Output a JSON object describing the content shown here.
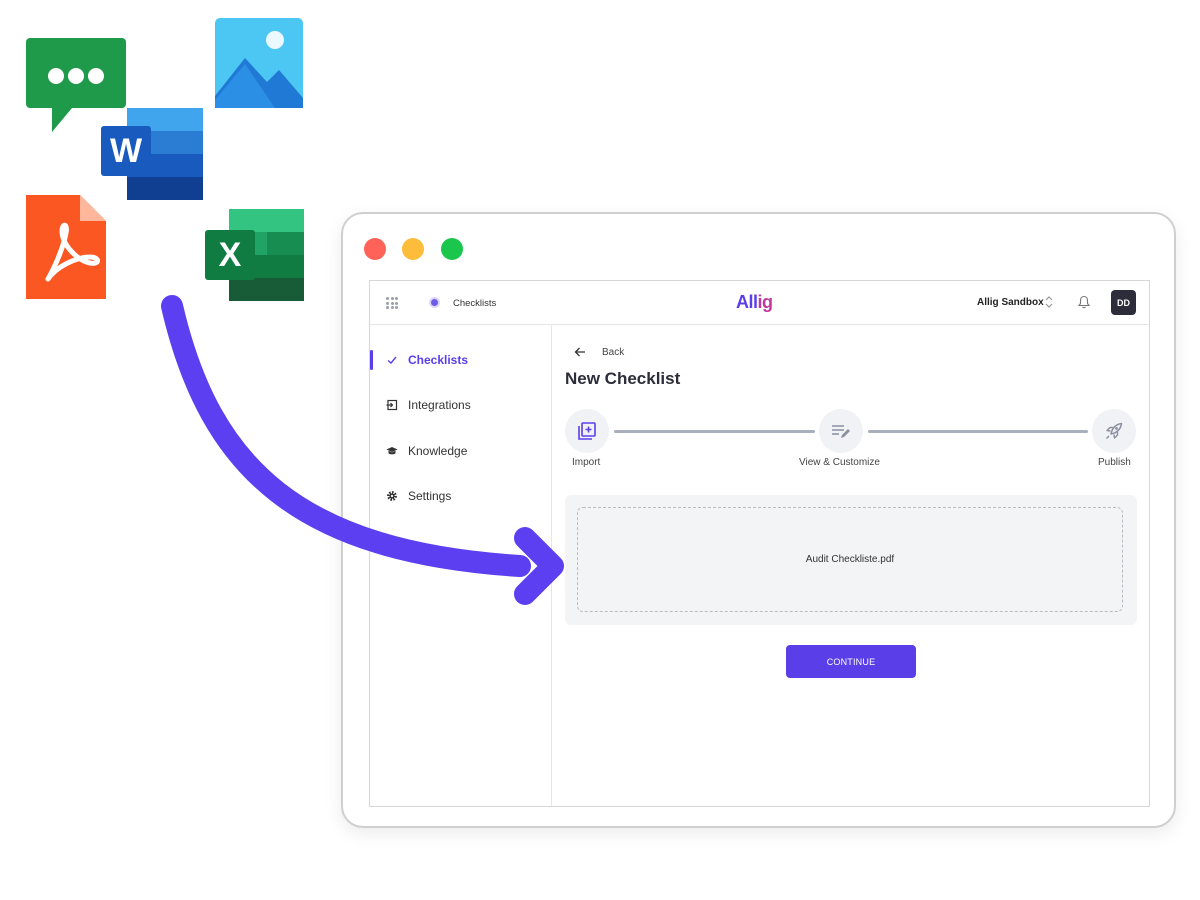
{
  "floating_icons": [
    "chat-icon",
    "image-icon",
    "word-icon",
    "pdf-icon",
    "excel-icon"
  ],
  "app": {
    "breadcrumb": "Checklists",
    "logo": {
      "prefix": "All",
      "suffix": "ig"
    },
    "workspace": "Allig Sandbox",
    "avatar_initials": "DD"
  },
  "sidebar": {
    "items": [
      {
        "label": "Checklists",
        "icon": "check-icon",
        "active": true
      },
      {
        "label": "Integrations",
        "icon": "login-icon",
        "active": false
      },
      {
        "label": "Knowledge",
        "icon": "graduation-cap-icon",
        "active": false
      },
      {
        "label": "Settings",
        "icon": "gear-icon",
        "active": false
      }
    ]
  },
  "main": {
    "back_label": "Back",
    "title": "New Checklist",
    "steps": [
      {
        "label": "Import",
        "icon": "library-add-icon"
      },
      {
        "label": "View & Customize",
        "icon": "edit-list-icon"
      },
      {
        "label": "Publish",
        "icon": "rocket-icon"
      }
    ],
    "dropzone_file": "Audit Checkliste.pdf",
    "continue_label": "CONTINUE"
  },
  "colors": {
    "accent": "#5a3fe8",
    "arrow": "#5b3ff0",
    "traffic_red": "#fe6259",
    "traffic_yellow": "#febc3b",
    "traffic_green": "#1ac64c"
  }
}
